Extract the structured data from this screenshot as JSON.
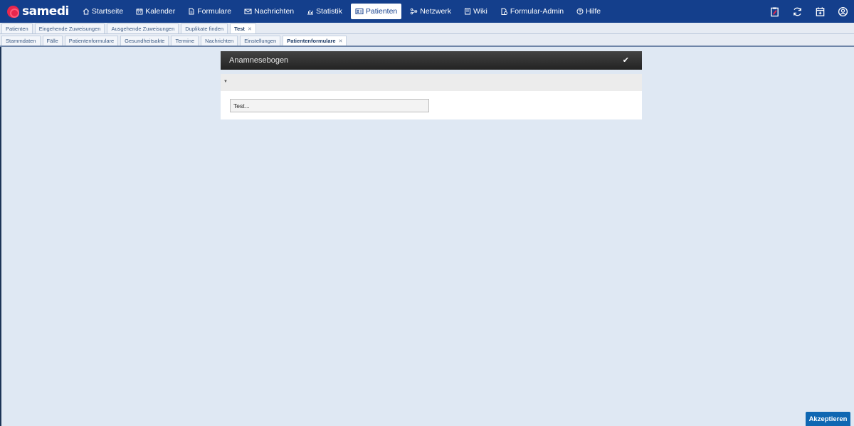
{
  "brand": {
    "name": "samedi",
    "color": "#e8274d"
  },
  "nav": {
    "items": [
      {
        "label": "Startseite",
        "icon": "home-icon"
      },
      {
        "label": "Kalender",
        "icon": "calendar-icon"
      },
      {
        "label": "Formulare",
        "icon": "document-icon"
      },
      {
        "label": "Nachrichten",
        "icon": "envelope-icon"
      },
      {
        "label": "Statistik",
        "icon": "bar-chart-icon"
      },
      {
        "label": "Patienten",
        "icon": "id-card-icon",
        "active": true
      },
      {
        "label": "Netzwerk",
        "icon": "network-icon"
      },
      {
        "label": "Wiki",
        "icon": "book-icon"
      },
      {
        "label": "Formular-Admin",
        "icon": "form-admin-icon"
      },
      {
        "label": "Hilfe",
        "icon": "help-icon"
      }
    ],
    "right_icons": [
      "clipboard-alert-icon",
      "sync-icon",
      "calendar-add-icon",
      "user-account-icon"
    ]
  },
  "tabs_primary": [
    {
      "label": "Patienten"
    },
    {
      "label": "Eingehende Zuweisungen"
    },
    {
      "label": "Ausgehende Zuweisungen"
    },
    {
      "label": "Duplikate finden"
    },
    {
      "label": "Test",
      "active": true,
      "closable": true
    }
  ],
  "tabs_secondary": [
    {
      "label": "Stammdaten"
    },
    {
      "label": "Fälle"
    },
    {
      "label": "Patientenformulare"
    },
    {
      "label": "Gesundheitsakte"
    },
    {
      "label": "Termine"
    },
    {
      "label": "Nachrichten"
    },
    {
      "label": "Einstellungen"
    },
    {
      "label": "Patientenformulare",
      "active": true,
      "closable": true
    }
  ],
  "form": {
    "title": "Anamnesebogen",
    "field_value": "Test..."
  },
  "actions": {
    "accept_label": "Akzeptieren"
  },
  "colors": {
    "topbar": "#143f8c",
    "background": "#dfe8f3",
    "accept": "#0f67b2"
  }
}
